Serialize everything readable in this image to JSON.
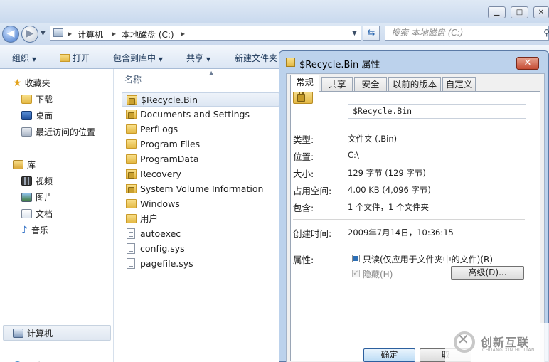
{
  "window": {
    "minimize_symbol": "▁",
    "maximize_symbol": "□",
    "close_symbol": "✕"
  },
  "address": {
    "breadcrumbs": [
      "计算机",
      "本地磁盘 (C:)"
    ],
    "separator": "▸",
    "search_placeholder": "搜索 本地磁盘 (C:)"
  },
  "toolbar": {
    "items": [
      "组织",
      "打开",
      "包含到库中",
      "共享",
      "新建文件夹"
    ]
  },
  "navpane": {
    "favorites": {
      "label": "收藏夹",
      "items": [
        "下载",
        "桌面",
        "最近访问的位置"
      ]
    },
    "libraries": {
      "label": "库",
      "items": [
        "视频",
        "图片",
        "文档",
        "音乐"
      ]
    },
    "computer": "计算机",
    "network": "网络"
  },
  "filelist": {
    "column_header": "名称",
    "files": [
      {
        "name": "$Recycle.Bin",
        "type": "locked-folder"
      },
      {
        "name": "Documents and Settings",
        "type": "locked-folder"
      },
      {
        "name": "PerfLogs",
        "type": "folder"
      },
      {
        "name": "Program Files",
        "type": "folder"
      },
      {
        "name": "ProgramData",
        "type": "folder"
      },
      {
        "name": "Recovery",
        "type": "locked-folder"
      },
      {
        "name": "System Volume Information",
        "type": "locked-folder"
      },
      {
        "name": "Windows",
        "type": "folder"
      },
      {
        "name": "用户",
        "type": "folder"
      },
      {
        "name": "autoexec",
        "type": "file"
      },
      {
        "name": "config.sys",
        "type": "file"
      },
      {
        "name": "pagefile.sys",
        "type": "file"
      }
    ],
    "selected_index": 0
  },
  "dialog": {
    "title": "$Recycle.Bin 属性",
    "tabs": [
      "常规",
      "共享",
      "安全",
      "以前的版本",
      "自定义"
    ],
    "active_tab": 0,
    "name_value": "$Recycle.Bin",
    "props": {
      "type_label": "类型:",
      "type_value": "文件夹 (.Bin)",
      "location_label": "位置:",
      "location_value": "C:\\",
      "size_label": "大小:",
      "size_value": "129 字节 (129 字节)",
      "disk_label": "占用空间:",
      "disk_value": "4.00 KB (4,096 字节)",
      "contains_label": "包含:",
      "contains_value": "1 个文件，1 个文件夹",
      "created_label": "创建时间:",
      "created_value": "2009年7月14日，10:36:15",
      "attributes_label": "属性:",
      "readonly_label": "只读(仅应用于文件夹中的文件)(R)",
      "hidden_label": "隐藏(H)",
      "advanced_label": "高级(D)..."
    },
    "ok_label": "确定",
    "cancel_label": "取"
  },
  "watermark": {
    "text": "创新互联",
    "sub": "CHUANG XIN HU LIAN"
  }
}
